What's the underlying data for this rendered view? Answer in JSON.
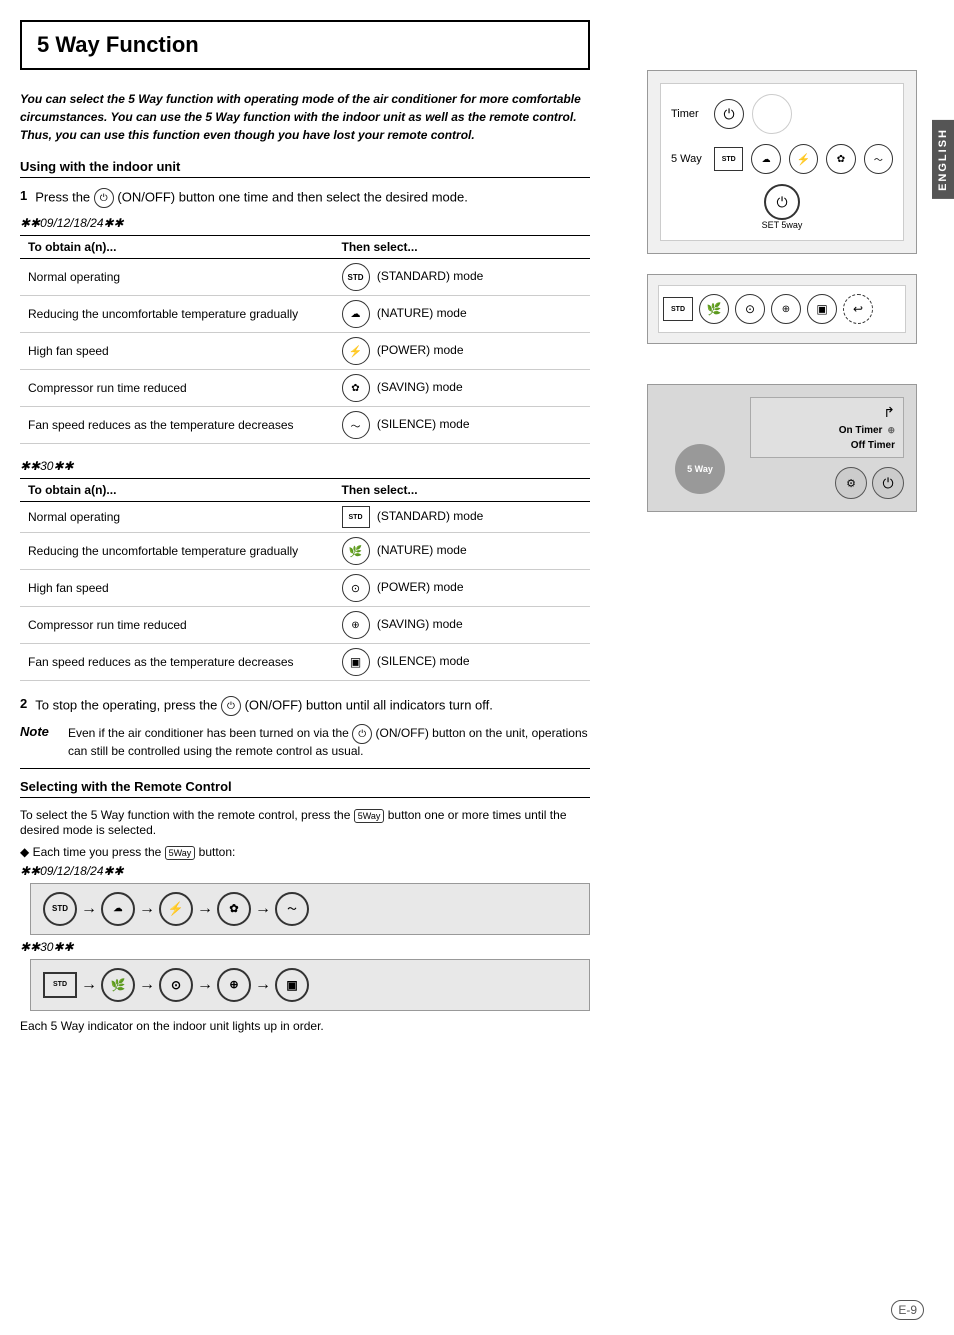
{
  "page": {
    "title": "5 Way Function",
    "intro": "You can select the 5 Way function with operating mode of the air conditioner for more comfortable circumstances. You can use the 5 Way function with the indoor unit as well as the remote control. Thus, you can use this function even though you have lost your remote control.",
    "section1_heading": "Using with the indoor unit",
    "step1_text": "Press the  (ON/OFF) button one time and then select the desired mode.",
    "model1": "✱✱09/12/18/24✱✱",
    "model2": "✱✱30✱✱",
    "table1_headers": [
      "To obtain a(n)...",
      "Then select..."
    ],
    "table1_rows": [
      [
        "Normal operating",
        "(STANDARD) mode"
      ],
      [
        "Reducing the uncomfortable temperature gradually",
        "(NATURE) mode"
      ],
      [
        "High fan speed",
        "(POWER) mode"
      ],
      [
        "Compressor run time reduced",
        "(SAVING) mode"
      ],
      [
        "Fan speed reduces as the temperature decreases",
        "(SILENCE) mode"
      ]
    ],
    "table2_headers": [
      "To obtain a(n)...",
      "Then select..."
    ],
    "table2_rows": [
      [
        "Normal operating",
        "(STANDARD) mode"
      ],
      [
        "Reducing the uncomfortable temperature gradually",
        "(NATURE) mode"
      ],
      [
        "High fan speed",
        "(POWER) mode"
      ],
      [
        "Compressor run time reduced",
        "(SAVING) mode"
      ],
      [
        "Fan speed reduces as the temperature decreases",
        "(SILENCE) mode"
      ]
    ],
    "step2_text": "To stop the operating, press the  (ON/OFF) button until all indicators turn off.",
    "note_label": "Note",
    "note_text": "Even if the air conditioner has been turned on via the  (ON/OFF) button on the unit, operations can still be controlled using the remote control as usual.",
    "section2_heading": "Selecting with the Remote Control",
    "remote_intro": "To select the 5 Way function with the remote control, press the  button one or more times until the desired mode is selected.",
    "bullet_text": "Each time you press the  button:",
    "bottom_note": "Each 5 Way indicator on the indoor unit lights up in order.",
    "english_tab": "ENGLISH",
    "page_number": "E-9",
    "diag1": {
      "timer_label": "Timer",
      "way5_label": "5 Way",
      "set_label": "SET 5way"
    },
    "diag3": {
      "on_timer": "On Timer",
      "off_timer": "Off Timer",
      "way5_label": "5 Way"
    },
    "modes_icons": [
      "STD",
      "☁",
      "⚡",
      "❄",
      "~"
    ],
    "seq1": [
      "STD",
      "☁",
      "⚡",
      "❄",
      "~"
    ],
    "seq2": [
      "STD",
      "🌿",
      "⊙",
      "❄",
      "▣"
    ]
  }
}
